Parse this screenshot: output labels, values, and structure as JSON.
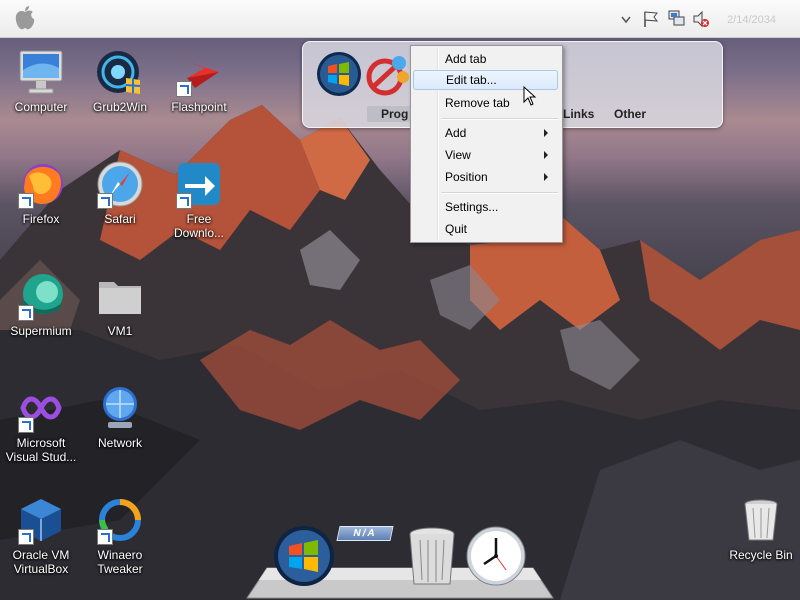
{
  "menubar": {
    "clock": "2/14/2034"
  },
  "desktop_icons": [
    {
      "label": "Computer"
    },
    {
      "label": "Grub2Win"
    },
    {
      "label": "Flashpoint"
    },
    {
      "label": "Firefox"
    },
    {
      "label": "Safari"
    },
    {
      "label": "Free Downlo..."
    },
    {
      "label": "Supermium"
    },
    {
      "label": "VM1"
    },
    {
      "label": "Microsoft Visual Stud..."
    },
    {
      "label": "Network"
    },
    {
      "label": "Oracle VM VirtualBox"
    },
    {
      "label": "Winaero Tweaker"
    },
    {
      "label": "Recycle Bin"
    }
  ],
  "launcher": {
    "tabs": [
      {
        "label": "Prog"
      },
      {
        "label": "Links"
      },
      {
        "label": "Other"
      }
    ]
  },
  "context_menu": {
    "items": [
      {
        "label": "Add tab"
      },
      {
        "label": "Edit tab..."
      },
      {
        "label": "Remove tab"
      },
      {
        "label": "Add"
      },
      {
        "label": "View"
      },
      {
        "label": "Position"
      },
      {
        "label": "Settings..."
      },
      {
        "label": "Quit"
      }
    ]
  },
  "dock": {
    "badge": "N/A"
  },
  "icons": {
    "menubar": [
      "apple-logo-icon",
      "chevron-down-icon",
      "flag-icon",
      "network-icon",
      "speaker-muted-icon"
    ],
    "dock": [
      "windows-orb-icon",
      "trash-can-icon",
      "clock-icon"
    ]
  },
  "colors": {
    "menu_highlight": "#dceafb",
    "menu_bg": "#f1f1f1"
  }
}
